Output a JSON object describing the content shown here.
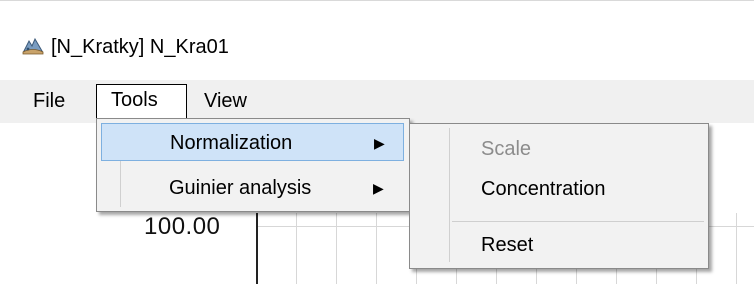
{
  "window": {
    "title": "[N_Kratky] N_Kra01",
    "icon": "app-logo-icon"
  },
  "menubar": {
    "items": [
      "File",
      "Tools",
      "View"
    ],
    "active": "Tools"
  },
  "tools_menu": {
    "items": [
      {
        "label": "Normalization",
        "has_submenu": true,
        "highlighted": true
      },
      {
        "label": "Guinier analysis",
        "has_submenu": true,
        "highlighted": false
      }
    ],
    "submenu_arrow": "▶"
  },
  "normalization_submenu": {
    "items": [
      {
        "label": "Scale",
        "enabled": false
      },
      {
        "label": "Concentration",
        "enabled": true
      },
      {
        "label": "Reset",
        "enabled": true
      }
    ]
  },
  "chart": {
    "y_tick_label": "100.00"
  },
  "colors": {
    "menubar_bg": "#f0f0f0",
    "highlight_bg": "#cfe3f8",
    "highlight_border": "#7eb0e0",
    "disabled_text": "#8c8c8c"
  }
}
